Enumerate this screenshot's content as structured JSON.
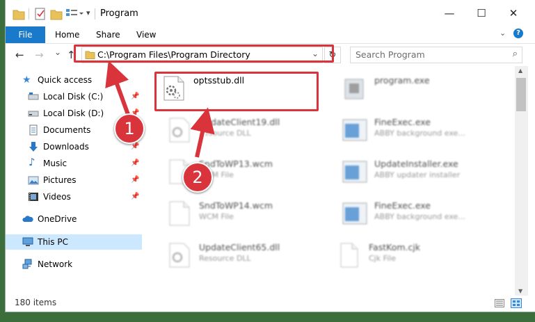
{
  "window": {
    "title": "Program",
    "controls": {
      "minimize": "—",
      "maximize": "☐",
      "close": "✕"
    }
  },
  "ribbon": {
    "tabs": [
      "File",
      "Home",
      "Share",
      "View"
    ],
    "help": "?"
  },
  "navigation": {
    "back": "←",
    "forward": "→",
    "recent": "⌄",
    "up": "↑",
    "address": "C:\\Program Files\\Program Directory",
    "search_placeholder": "Search Program"
  },
  "sidebar": {
    "items": [
      {
        "label": "Quick access",
        "icon": "star-icon",
        "pinned": false
      },
      {
        "label": "Local Disk (C:)",
        "icon": "drive-icon",
        "pinned": true
      },
      {
        "label": "Local Disk (D:)",
        "icon": "drive-icon",
        "pinned": true
      },
      {
        "label": "Documents",
        "icon": "documents-icon",
        "pinned": true
      },
      {
        "label": "Downloads",
        "icon": "download-icon",
        "pinned": true
      },
      {
        "label": "Music",
        "icon": "music-icon",
        "pinned": true
      },
      {
        "label": "Pictures",
        "icon": "pictures-icon",
        "pinned": true
      },
      {
        "label": "Videos",
        "icon": "videos-icon",
        "pinned": true
      },
      {
        "label": "OneDrive",
        "icon": "cloud-icon",
        "pinned": false
      },
      {
        "label": "This PC",
        "icon": "computer-icon",
        "pinned": false
      },
      {
        "label": "Network",
        "icon": "network-icon",
        "pinned": false
      }
    ]
  },
  "files": [
    {
      "name": "optsstub.dll",
      "type": "",
      "icon": "dll-file-icon"
    },
    {
      "name": "program.exe",
      "type": "",
      "icon": "exe-file-icon"
    },
    {
      "name": "UpdateClient19.dll",
      "type": "Resource DLL",
      "icon": "dll-file-icon"
    },
    {
      "name": "FineExec.exe",
      "type": "ABBY background exe...",
      "icon": "app-window-icon"
    },
    {
      "name": "SndToWP13.wcm",
      "type": "WCM File",
      "icon": "blank-file-icon"
    },
    {
      "name": "UpdateInstaller.exe",
      "type": "ABBY updater installer",
      "icon": "app-window-icon"
    },
    {
      "name": "SndToWP14.wcm",
      "type": "WCM File",
      "icon": "blank-file-icon"
    },
    {
      "name": "FineExec.exe",
      "type": "ABBY background exe...",
      "icon": "app-window-icon"
    },
    {
      "name": "UpdateClient65.dll",
      "type": "Resource DLL",
      "icon": "dll-file-icon"
    },
    {
      "name": "FastKom.cjk",
      "type": "Cjk File",
      "icon": "blank-file-icon"
    }
  ],
  "status": {
    "count": "180 items"
  },
  "annotations": {
    "marker1": "1",
    "marker2": "2"
  },
  "colors": {
    "accent": "#1979ca",
    "highlight": "#d9343c",
    "selection": "#cce8ff"
  }
}
